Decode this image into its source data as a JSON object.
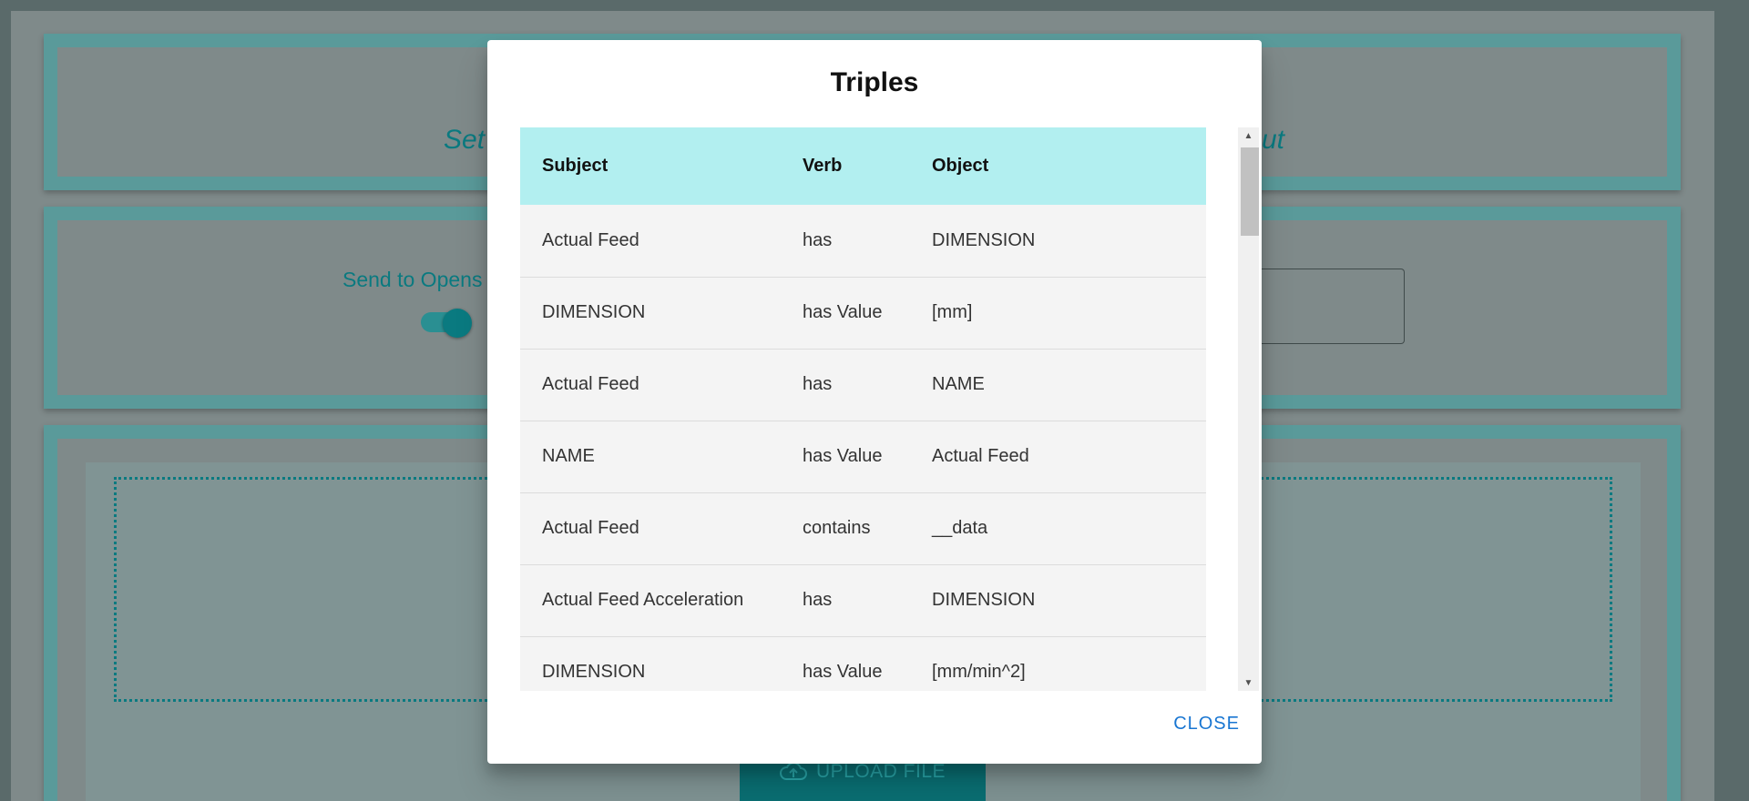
{
  "background": {
    "title_left": "Set",
    "title_right": "ut",
    "toggle_label": "Send to Opens",
    "upload_button": "UPLOAD FILE"
  },
  "modal": {
    "title": "Triples",
    "close_label": "CLOSE",
    "columns": [
      "Subject",
      "Verb",
      "Object"
    ],
    "rows": [
      {
        "subject": "Actual Feed",
        "verb": "has",
        "object": "DIMENSION"
      },
      {
        "subject": "DIMENSION",
        "verb": "has Value",
        "object": "[mm]"
      },
      {
        "subject": "Actual Feed",
        "verb": "has",
        "object": "NAME"
      },
      {
        "subject": "NAME",
        "verb": "has Value",
        "object": "Actual Feed"
      },
      {
        "subject": "Actual Feed",
        "verb": "contains",
        "object": "__data"
      },
      {
        "subject": "Actual Feed Acceleration",
        "verb": "has",
        "object": "DIMENSION"
      },
      {
        "subject": "DIMENSION",
        "verb": "has Value",
        "object": "[mm/min^2]"
      }
    ]
  },
  "colors": {
    "accent": "#0a7a80",
    "header_bg": "#b2eff0",
    "close_color": "#1976d2"
  }
}
